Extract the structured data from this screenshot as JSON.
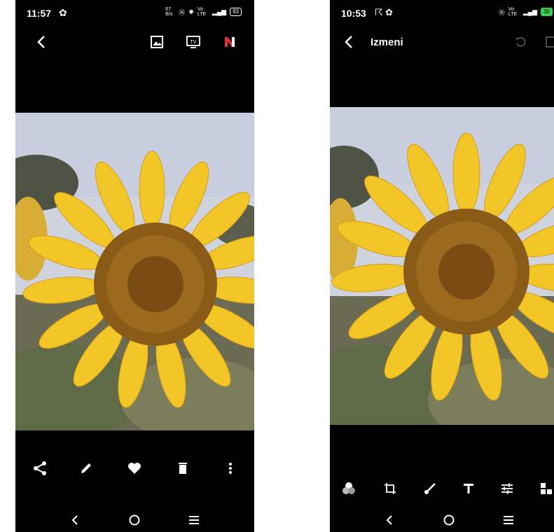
{
  "left_screen": {
    "status": {
      "time": "11:57",
      "net_speed": "67 B/s",
      "network": "Vo LTE",
      "battery": "93"
    },
    "toolbar": [
      "share-icon",
      "edit-icon",
      "heart-icon",
      "delete-icon",
      "more-icon"
    ],
    "top_actions": [
      "gallery-icon",
      "cast-tv-icon",
      "nfc-app-icon"
    ]
  },
  "right_screen": {
    "status": {
      "time": "10:53",
      "network": "Vo LTE",
      "battery": "30"
    },
    "title": "Izmeni",
    "edit_tools": [
      "filters-icon",
      "crop-rotate-icon",
      "brush-icon",
      "text-icon",
      "adjust-icon",
      "more-tools-icon"
    ],
    "top_actions": [
      "undo-icon",
      "save-icon"
    ]
  },
  "nav": [
    "back-nav-icon",
    "home-nav-icon",
    "menu-nav-icon"
  ],
  "colors": {
    "background": "#000000",
    "accent_red": "#e8312f",
    "petal": "#f2c626",
    "disk": "#8a5a17"
  }
}
